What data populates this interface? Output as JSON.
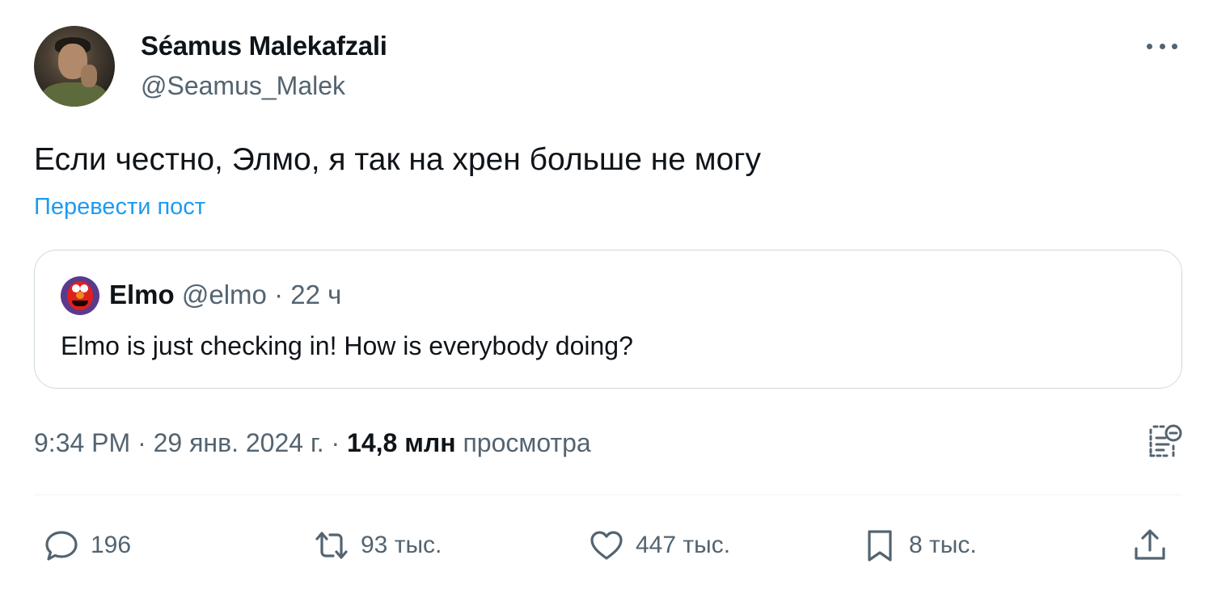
{
  "author": {
    "display_name": "Séamus Malekafzali",
    "handle": "@Seamus_Malek",
    "avatar_icon": "profile-photo"
  },
  "more_icon": "ellipsis-icon",
  "post": {
    "text": "Если честно, Элмо, я так на хрен больше не могу",
    "translate_label": "Перевести пост"
  },
  "quote": {
    "display_name": "Elmo",
    "handle": "@elmo",
    "separator": "·",
    "time": "22 ч",
    "text": "Elmo is just checking in! How is everybody doing?"
  },
  "meta": {
    "time": "9:34 PM",
    "sep1": " · ",
    "date": "29 янв. 2024 г.",
    "sep2": " · ",
    "views_count": "14,8 млн",
    "views_label": " просмотра"
  },
  "actions": {
    "replies": "196",
    "reposts": "93 тыс.",
    "likes": "447 тыс.",
    "bookmarks": "8 тыс."
  },
  "colors": {
    "accent": "#1d9bf0",
    "secondary_text": "#536471",
    "primary_text": "#0f1419",
    "border": "#cfd9de"
  }
}
